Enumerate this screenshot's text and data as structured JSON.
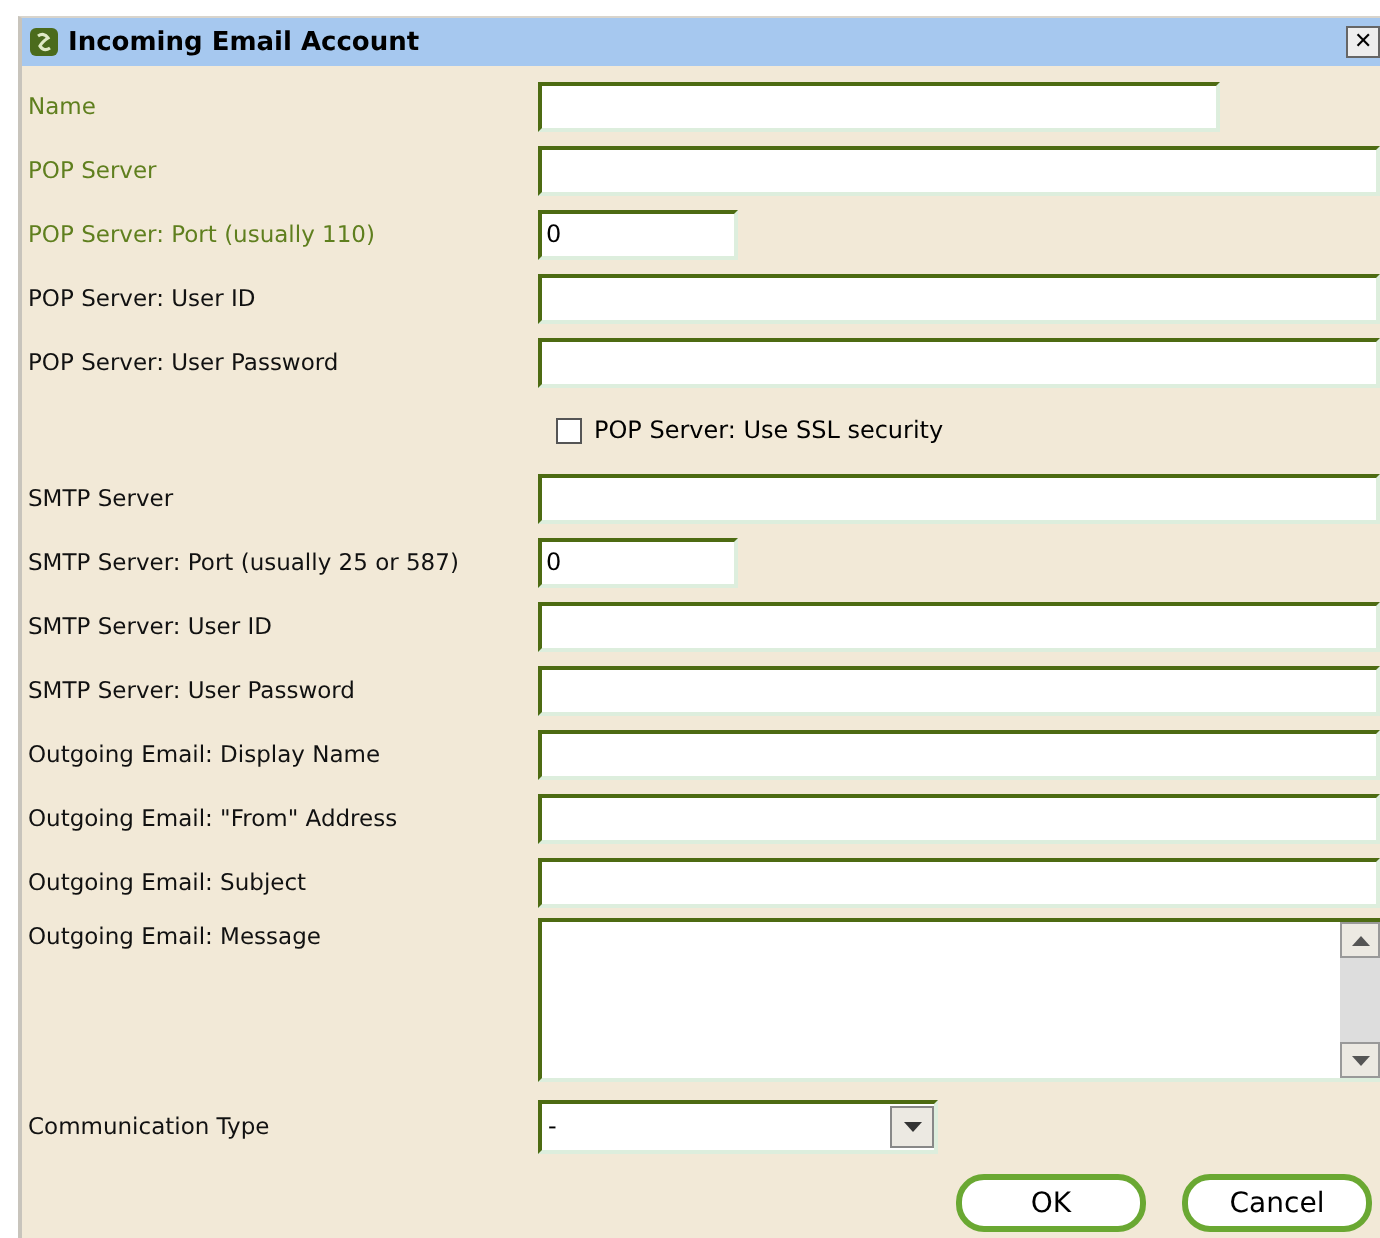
{
  "window": {
    "title": "Incoming Email Account",
    "close": "✕"
  },
  "fields": [
    {
      "kind": "medium",
      "label": "Name",
      "required": true
    },
    {
      "kind": "text",
      "label": "POP Server",
      "required": true
    },
    {
      "kind": "short",
      "label": "POP Server: Port (usually 110)",
      "required": true,
      "value": "0"
    },
    {
      "kind": "text",
      "label": "POP Server: User ID",
      "required": false
    },
    {
      "kind": "text",
      "label": "POP Server: User Password",
      "required": false
    },
    {
      "kind": "checkbox",
      "label": "POP Server: Use SSL security",
      "checked": false
    },
    {
      "kind": "text",
      "label": "SMTP Server",
      "required": false
    },
    {
      "kind": "short",
      "label": "SMTP Server: Port (usually 25 or 587)",
      "required": false,
      "value": "0"
    },
    {
      "kind": "text",
      "label": "SMTP Server: User ID",
      "required": false
    },
    {
      "kind": "text",
      "label": "SMTP Server: User Password",
      "required": false
    },
    {
      "kind": "text",
      "label": "Outgoing Email: Display Name",
      "required": false
    },
    {
      "kind": "text",
      "label": "Outgoing Email: \"From\" Address",
      "required": false
    },
    {
      "kind": "text",
      "label": "Outgoing Email: Subject",
      "required": false
    },
    {
      "kind": "textarea",
      "label": "Outgoing Email: Message",
      "required": false
    },
    {
      "kind": "select",
      "label": "Communication Type",
      "required": false,
      "value": "-"
    }
  ],
  "buttons": [
    "OK",
    "Cancel"
  ]
}
